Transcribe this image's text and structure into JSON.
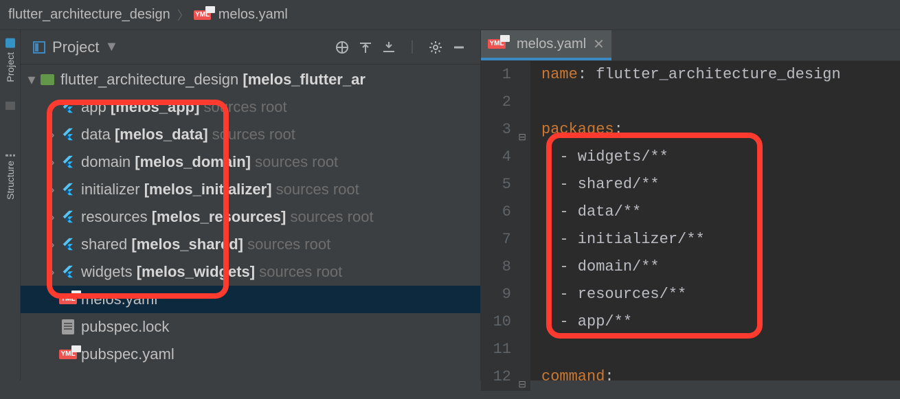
{
  "breadcrumb": {
    "root": "flutter_architecture_design",
    "file": "melos.yaml"
  },
  "project_panel": {
    "title": "Project",
    "root_node": {
      "name": "flutter_architecture_design",
      "module": "[melos_flutter_ar"
    },
    "modules": [
      {
        "name": "app",
        "module": "[melos_app]",
        "suffix": "sources root"
      },
      {
        "name": "data",
        "module": "[melos_data]",
        "suffix": "sources root"
      },
      {
        "name": "domain",
        "module": "[melos_domain]",
        "suffix": "sources root"
      },
      {
        "name": "initializer",
        "module": "[melos_initializer]",
        "suffix": "sources root"
      },
      {
        "name": "resources",
        "module": "[melos_resources]",
        "suffix": "sources root"
      },
      {
        "name": "shared",
        "module": "[melos_shared]",
        "suffix": "sources root"
      },
      {
        "name": "widgets",
        "module": "[melos_widgets]",
        "suffix": "sources root"
      }
    ],
    "files": [
      {
        "name": "melos.yaml",
        "icon": "yaml",
        "selected": true
      },
      {
        "name": "pubspec.lock",
        "icon": "file",
        "selected": false
      },
      {
        "name": "pubspec.yaml",
        "icon": "yaml",
        "selected": false
      }
    ]
  },
  "sidebar_tabs": {
    "project": "Project",
    "structure": "Structure"
  },
  "editor_tab": {
    "title": "melos.yaml"
  },
  "chart_data": {
    "type": "table",
    "file": "melos.yaml",
    "content": {
      "name": "flutter_architecture_design",
      "packages": [
        "widgets/**",
        "shared/**",
        "data/**",
        "initializer/**",
        "domain/**",
        "resources/**",
        "app/**"
      ],
      "command": null
    }
  },
  "code_lines": [
    {
      "n": 1,
      "html": "<span class='tok-key'>name</span><span class='tok-val'>: flutter_architecture_design</span>"
    },
    {
      "n": 2,
      "html": ""
    },
    {
      "n": 3,
      "html": "<span class='tok-key'>packages</span><span class='tok-val'>:</span>",
      "fold": true
    },
    {
      "n": 4,
      "html": "  <span class='tok-dash'>- widgets/**</span>"
    },
    {
      "n": 5,
      "html": "  <span class='tok-dash'>- shared/**</span>"
    },
    {
      "n": 6,
      "html": "  <span class='tok-dash'>- data/**</span>"
    },
    {
      "n": 7,
      "html": "  <span class='tok-dash'>- initializer/**</span>"
    },
    {
      "n": 8,
      "html": "  <span class='tok-dash'>- domain/**</span>"
    },
    {
      "n": 9,
      "html": "  <span class='tok-dash'>- resources/**</span>"
    },
    {
      "n": 10,
      "html": "  <span class='tok-dash'>- app/**</span>"
    },
    {
      "n": 11,
      "html": ""
    },
    {
      "n": 12,
      "html": "<span class='tok-key'>command</span><span class='tok-val'>:</span>",
      "fold": true
    }
  ]
}
